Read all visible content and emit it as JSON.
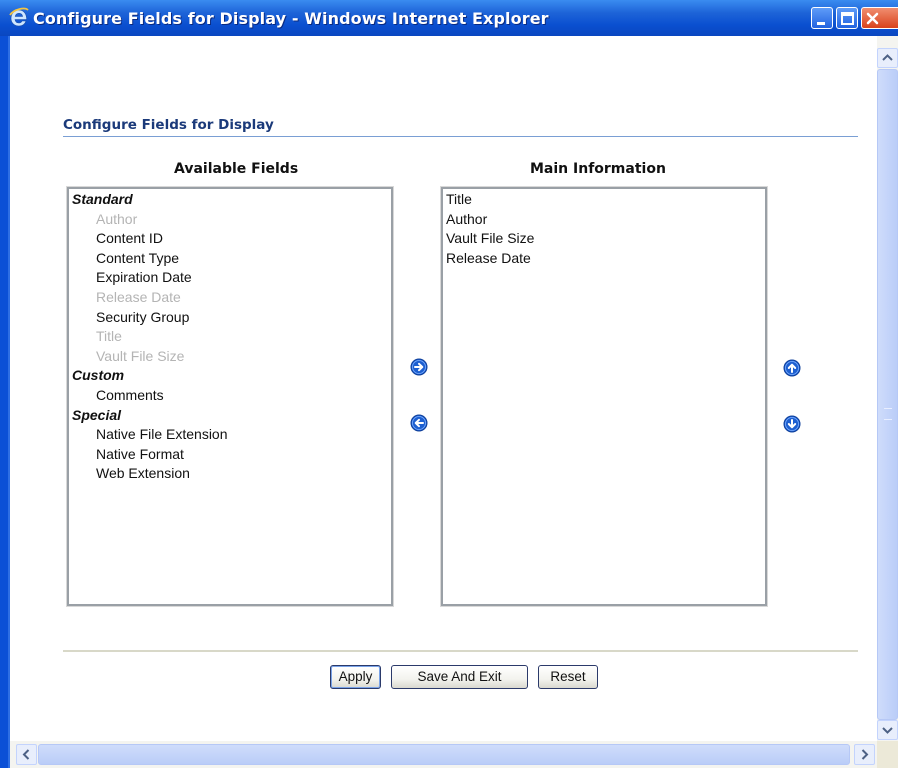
{
  "window": {
    "title": "Configure Fields for Display - Windows Internet Explorer"
  },
  "page": {
    "section_title": "Configure Fields for Display",
    "available_header": "Available Fields",
    "main_header": "Main Information"
  },
  "available_fields": [
    {
      "label": "Standard",
      "type": "group"
    },
    {
      "label": "Author",
      "type": "item",
      "disabled": true
    },
    {
      "label": "Content ID",
      "type": "item",
      "disabled": false
    },
    {
      "label": "Content Type",
      "type": "item",
      "disabled": false
    },
    {
      "label": "Expiration Date",
      "type": "item",
      "disabled": false
    },
    {
      "label": "Release Date",
      "type": "item",
      "disabled": true
    },
    {
      "label": "Security Group",
      "type": "item",
      "disabled": false
    },
    {
      "label": "Title",
      "type": "item",
      "disabled": true
    },
    {
      "label": "Vault File Size",
      "type": "item",
      "disabled": true
    },
    {
      "label": "Custom",
      "type": "group"
    },
    {
      "label": "Comments",
      "type": "item",
      "disabled": false
    },
    {
      "label": "Special",
      "type": "group"
    },
    {
      "label": "Native File Extension",
      "type": "item",
      "disabled": false
    },
    {
      "label": "Native Format",
      "type": "item",
      "disabled": false
    },
    {
      "label": "Web Extension",
      "type": "item",
      "disabled": false
    }
  ],
  "main_information": [
    "Title",
    "Author",
    "Vault File Size",
    "Release Date"
  ],
  "buttons": {
    "apply": "Apply",
    "save_exit": "Save And Exit",
    "reset": "Reset"
  },
  "icons": {
    "move_right": "arrow-right-circle-icon",
    "move_left": "arrow-left-circle-icon",
    "move_up": "arrow-up-circle-icon",
    "move_down": "arrow-down-circle-icon"
  },
  "colors": {
    "titlebar": "#0a4fd0",
    "section_title": "#1b3a7a",
    "arrow_button": "#1d5fd0",
    "disabled_text": "#b4b4b4"
  }
}
